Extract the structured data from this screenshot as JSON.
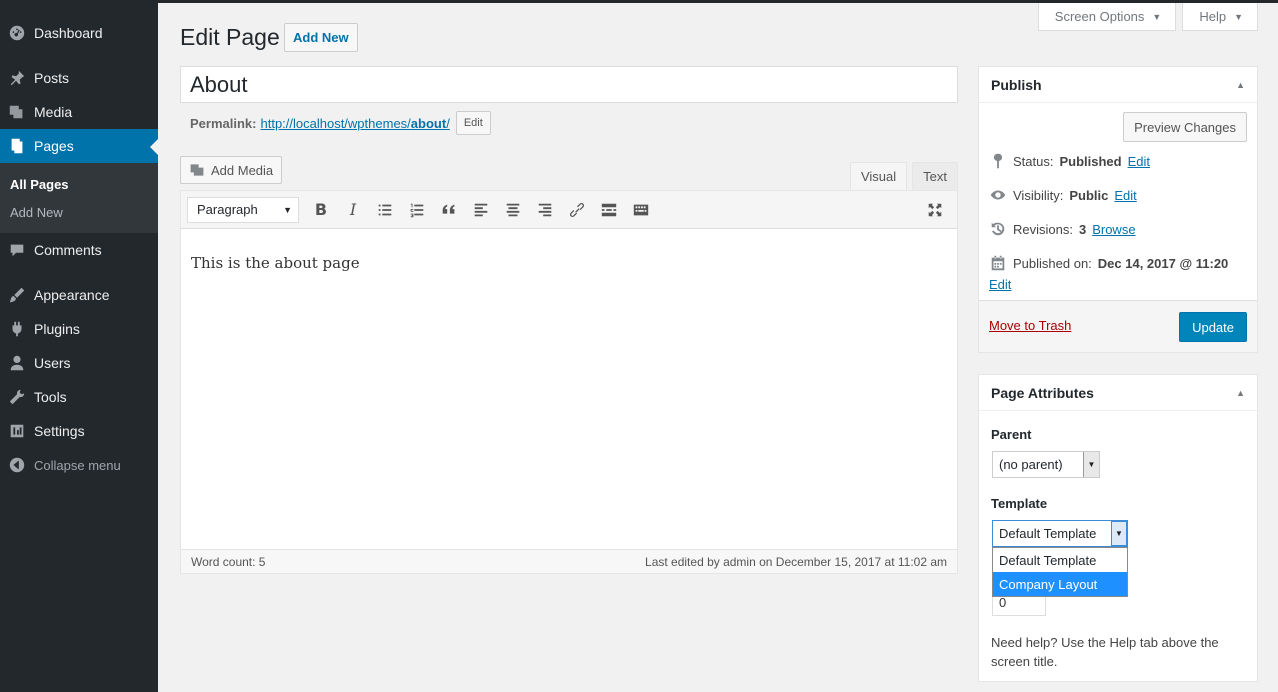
{
  "sidebar": {
    "items": [
      {
        "label": "Dashboard",
        "icon": "dashboard-icon"
      },
      {
        "label": "Posts",
        "icon": "pin-icon"
      },
      {
        "label": "Media",
        "icon": "media-icon"
      },
      {
        "label": "Pages",
        "icon": "pages-icon"
      },
      {
        "label": "Comments",
        "icon": "comment-icon"
      },
      {
        "label": "Appearance",
        "icon": "brush-icon"
      },
      {
        "label": "Plugins",
        "icon": "plugin-icon"
      },
      {
        "label": "Users",
        "icon": "user-icon"
      },
      {
        "label": "Tools",
        "icon": "wrench-icon"
      },
      {
        "label": "Settings",
        "icon": "settings-icon"
      }
    ],
    "submenu": [
      "All Pages",
      "Add New"
    ],
    "collapse_label": "Collapse menu"
  },
  "screen_meta": {
    "screen_options": "Screen Options",
    "help": "Help"
  },
  "header": {
    "title": "Edit Page",
    "add_new": "Add New"
  },
  "post": {
    "title": "About",
    "permalink_label": "Permalink:",
    "permalink_base": "http://localhost/wpthemes/",
    "permalink_slug": "about",
    "permalink_end": "/",
    "permalink_edit": "Edit"
  },
  "editor": {
    "add_media": "Add Media",
    "tab_visual": "Visual",
    "tab_text": "Text",
    "format": "Paragraph",
    "content": "This is the about page",
    "word_count": "Word count: 5",
    "last_edited": "Last edited by admin on December 15, 2017 at 11:02 am"
  },
  "publish": {
    "title": "Publish",
    "preview": "Preview Changes",
    "status_label": "Status:",
    "status_value": "Published",
    "visibility_label": "Visibility:",
    "visibility_value": "Public",
    "revisions_label": "Revisions:",
    "revisions_value": "3",
    "browse": "Browse",
    "published_label": "Published on:",
    "published_value": "Dec 14, 2017 @ 11:20",
    "edit": "Edit",
    "trash": "Move to Trash",
    "update": "Update"
  },
  "attributes": {
    "title": "Page Attributes",
    "parent_label": "Parent",
    "parent_value": "(no parent)",
    "template_label": "Template",
    "template_value": "Default Template",
    "template_options": [
      "Default Template",
      "Company Layout"
    ],
    "order_value": "0",
    "help": "Need help? Use the Help tab above the screen title."
  },
  "colors": {
    "accent": "#0073aa",
    "sidebar": "#23282d",
    "update": "#0085ba"
  }
}
